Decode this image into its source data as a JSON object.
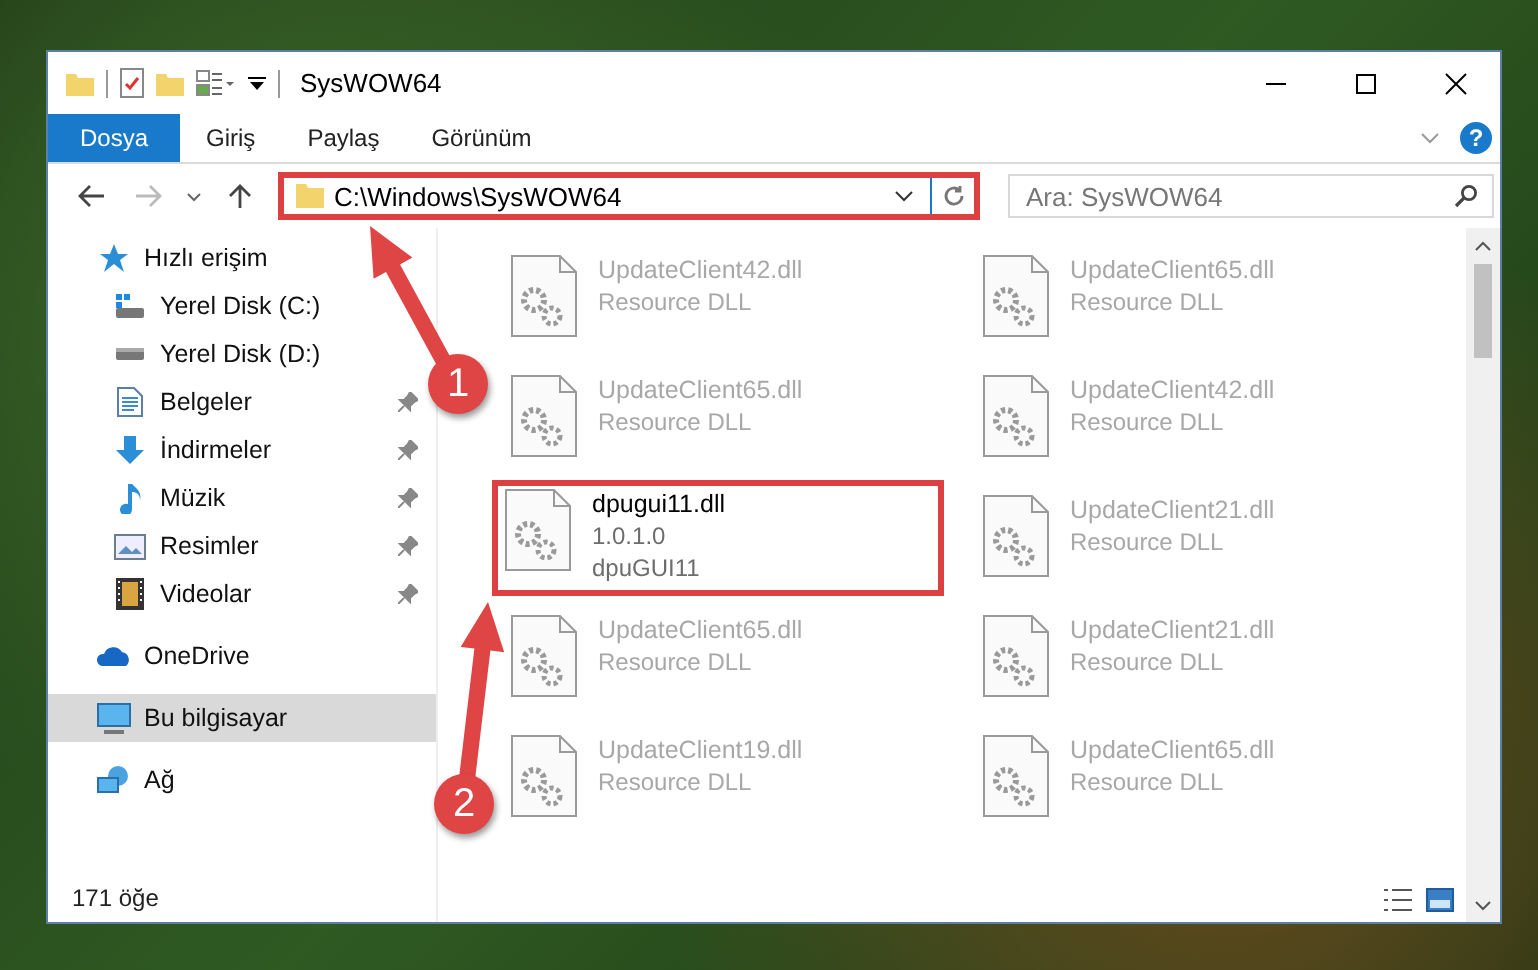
{
  "window": {
    "title": "SysWOW64"
  },
  "ribbon": {
    "tabs": [
      {
        "label": "Dosya",
        "selected": true
      },
      {
        "label": "Giriş",
        "selected": false
      },
      {
        "label": "Paylaş",
        "selected": false
      },
      {
        "label": "Görünüm",
        "selected": false
      }
    ],
    "help": "?"
  },
  "address_bar": {
    "path": "C:\\Windows\\SysWOW64",
    "highlighted": true
  },
  "search": {
    "placeholder": "Ara: SysWOW64"
  },
  "navigation": [
    {
      "label": "Hızlı erişim",
      "kind": "star",
      "selected": false,
      "children": [
        {
          "label": "Yerel Disk (C:)",
          "kind": "system-drive",
          "pinned": false,
          "selected": false
        },
        {
          "label": "Yerel Disk (D:)",
          "kind": "drive",
          "pinned": false,
          "selected": false
        },
        {
          "label": "Belgeler",
          "kind": "documents",
          "pinned": true,
          "selected": false
        },
        {
          "label": "İndirmeler",
          "kind": "downloads",
          "pinned": true,
          "selected": false
        },
        {
          "label": "Müzik",
          "kind": "music",
          "pinned": true,
          "selected": false
        },
        {
          "label": "Resimler",
          "kind": "pictures",
          "pinned": true,
          "selected": false
        },
        {
          "label": "Videolar",
          "kind": "videos",
          "pinned": true,
          "selected": false
        }
      ]
    },
    {
      "label": "OneDrive",
      "kind": "cloud",
      "selected": false
    },
    {
      "label": "Bu bilgisayar",
      "kind": "computer",
      "selected": true
    },
    {
      "label": "Ağ",
      "kind": "network",
      "selected": false
    }
  ],
  "files": [
    {
      "name": "UpdateClient42.dll",
      "details": [
        "Resource DLL"
      ],
      "dimmed": true,
      "highlighted": false
    },
    {
      "name": "UpdateClient65.dll",
      "details": [
        "Resource DLL"
      ],
      "dimmed": true,
      "highlighted": false
    },
    {
      "name": "UpdateClient65.dll",
      "details": [
        "Resource DLL"
      ],
      "dimmed": true,
      "highlighted": false
    },
    {
      "name": "UpdateClient42.dll",
      "details": [
        "Resource DLL"
      ],
      "dimmed": true,
      "highlighted": false
    },
    {
      "name": "dpugui11.dll",
      "details": [
        "1.0.1.0",
        "dpuGUI11"
      ],
      "dimmed": false,
      "highlighted": true
    },
    {
      "name": "UpdateClient21.dll",
      "details": [
        "Resource DLL"
      ],
      "dimmed": true,
      "highlighted": false
    },
    {
      "name": "UpdateClient65.dll",
      "details": [
        "Resource DLL"
      ],
      "dimmed": true,
      "highlighted": false
    },
    {
      "name": "UpdateClient21.dll",
      "details": [
        "Resource DLL"
      ],
      "dimmed": true,
      "highlighted": false
    },
    {
      "name": "UpdateClient19.dll",
      "details": [
        "Resource DLL"
      ],
      "dimmed": true,
      "highlighted": false
    },
    {
      "name": "UpdateClient65.dll",
      "details": [
        "Resource DLL"
      ],
      "dimmed": true,
      "highlighted": false
    }
  ],
  "status_bar": {
    "item_count": "171 öğe"
  },
  "annotations": [
    {
      "label": "1"
    },
    {
      "label": "2"
    }
  ]
}
